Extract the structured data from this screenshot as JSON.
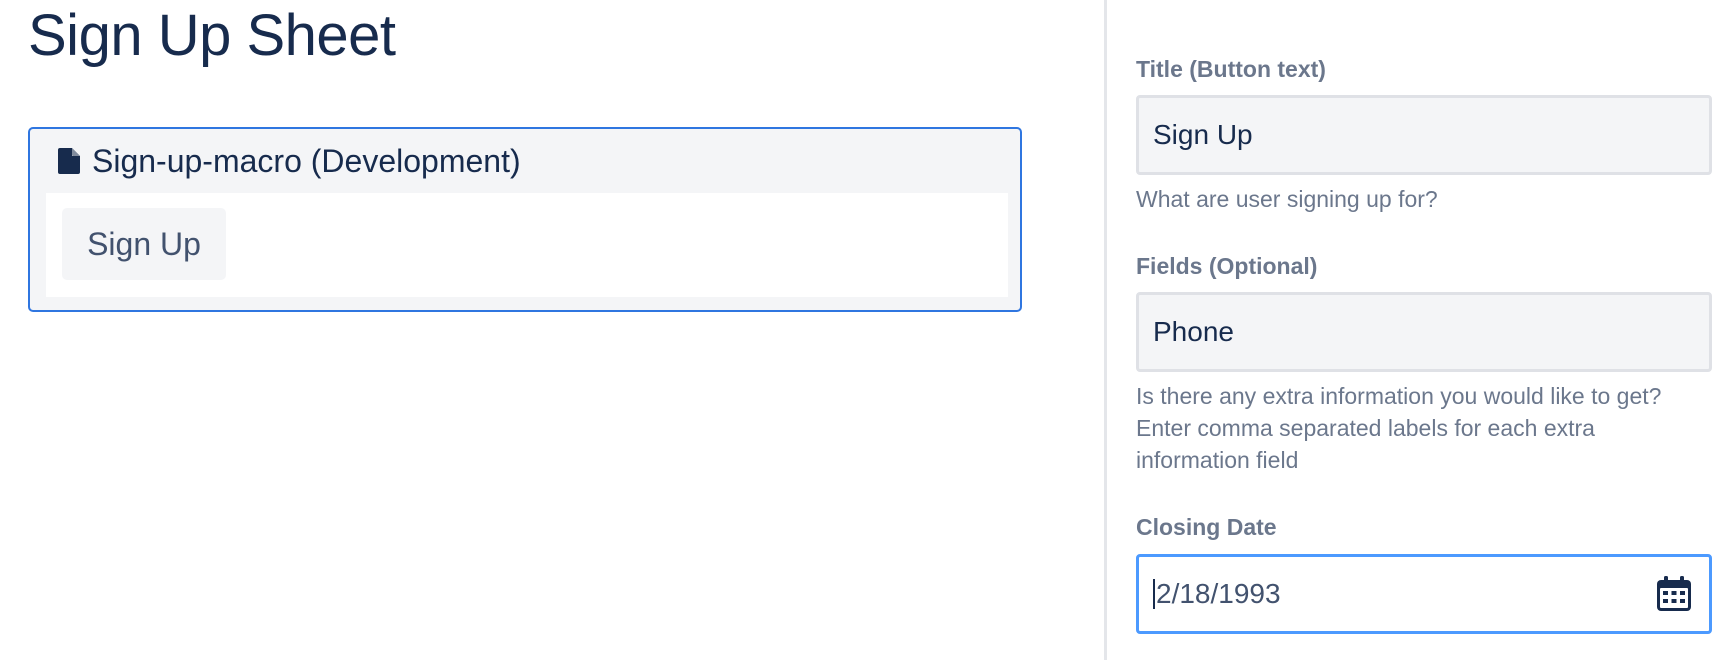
{
  "page": {
    "title": "Sign Up Sheet"
  },
  "macro": {
    "icon": "document-icon",
    "title": "Sign-up-macro (Development)",
    "button_label": "Sign Up"
  },
  "panel": {
    "title_field": {
      "label": "Title (Button text)",
      "value": "Sign Up",
      "help": "What are user signing up for?"
    },
    "fields_field": {
      "label": "Fields (Optional)",
      "value": "Phone",
      "help": "Is there any extra information you would like to get? Enter comma separated labels for each extra information field"
    },
    "closing_date_field": {
      "label": "Closing Date",
      "value": "2/18/1993",
      "icon": "calendar-icon"
    }
  },
  "colors": {
    "accent": "#2f76e0",
    "focus": "#4c9aff",
    "text_primary": "#172b4d",
    "text_secondary": "#6b778c",
    "surface": "#f4f5f7"
  }
}
